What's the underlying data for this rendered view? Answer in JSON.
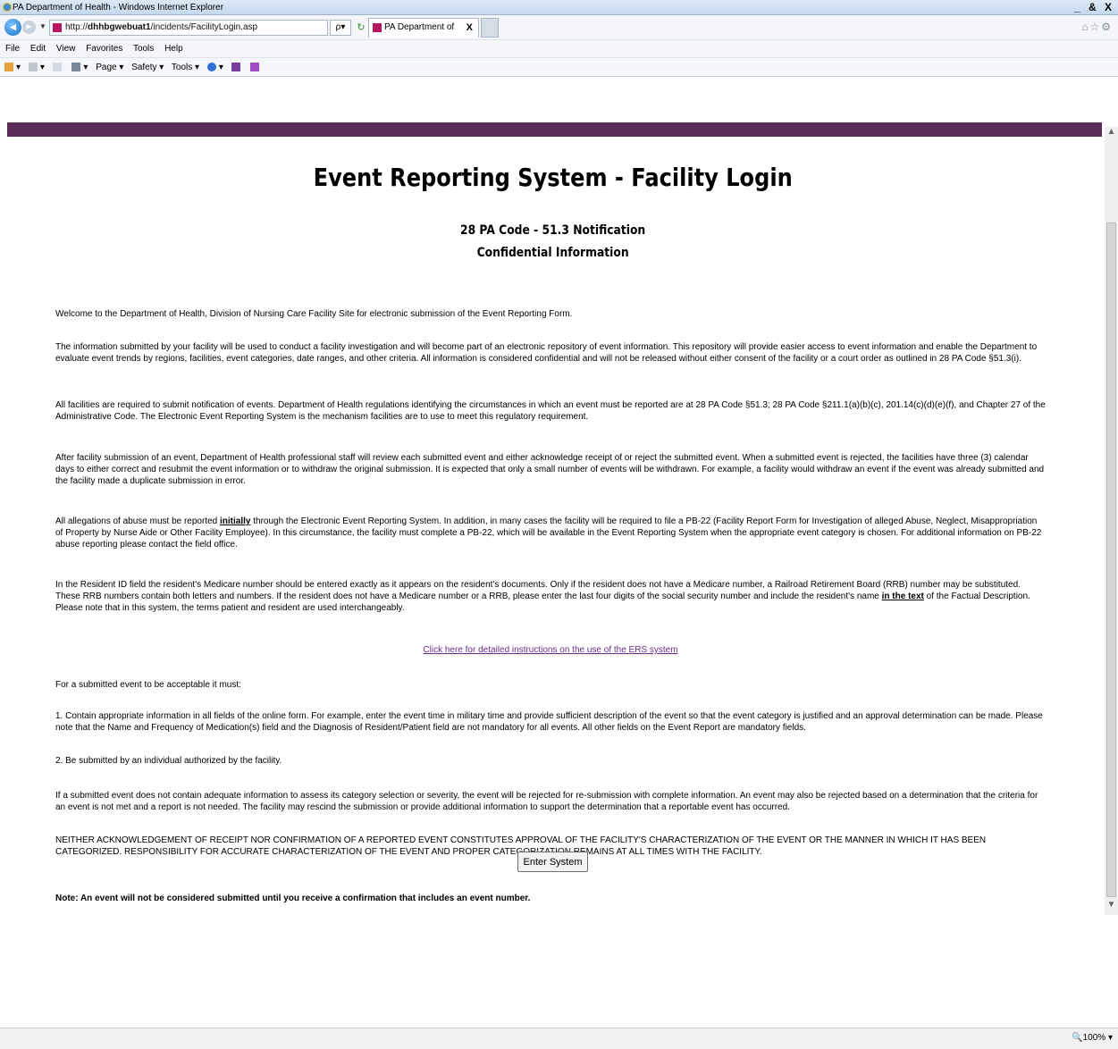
{
  "window": {
    "title": "PA Department of Health - Windows Internet Explorer",
    "controls": "_ & X"
  },
  "browser": {
    "url_prefix": "http://",
    "url_host": "dhhbgwebuat1",
    "url_path": "/incidents/FacilityLogin.asp",
    "tab_title": "PA Department of Health",
    "tab_close": "X",
    "search_glyph": "ρ▾",
    "menu": [
      "File",
      "Edit",
      "View",
      "Favorites",
      "Tools",
      "Help"
    ],
    "command_bar": [
      "Page ▾",
      "Safety ▾",
      "Tools ▾"
    ],
    "zoom": "100%"
  },
  "page": {
    "title": "Event Reporting System - Facility Login",
    "subtitle1": "28 PA Code - 51.3 Notification",
    "subtitle2": "Confidential Information",
    "p_welcome": "Welcome to the Department of Health, Division of Nursing Care Facility Site for electronic submission of the Event Reporting Form.",
    "p_info": "The information submitted by your facility will be used to conduct a facility investigation and will become part of an electronic repository of event information. This repository will provide easier access to event information and enable the Department to evaluate event trends by regions, facilities, event categories, date ranges, and other criteria. All information is considered confidential and will not be released without either consent of the facility or a court order as outlined in 28 PA Code §51.3(i).",
    "p_required": "All facilities are required to submit notification of events. Department of Health regulations identifying the circumstances in which an event must be reported are at 28 PA Code §51.3; 28 PA Code §211.1(a)(b)(c), 201.14(c)(d)(e)(f), and Chapter 27 of the Administrative Code. The Electronic Event Reporting System is the mechanism facilities are to use to meet this regulatory requirement.",
    "p_after": "After facility submission of an event, Department of Health professional staff will review each submitted event and either acknowledge receipt of or reject the submitted event. When a submitted event is rejected, the facilities have three (3) calendar days to either correct and resubmit the event information or to withdraw the original submission. It is expected that only a small number of events will be withdrawn. For example, a facility would withdraw an event if the event was already submitted and the facility made a duplicate submission in error.",
    "p_abuse_a": "All allegations of abuse must be reported ",
    "p_abuse_b": "initially",
    "p_abuse_c": " through the Electronic Event Reporting System. In addition, in many cases the facility will be required to file a PB-22 (Facility Report Form for Investigation of alleged Abuse, Neglect, Misappropriation of Property by Nurse Aide or Other Facility Employee). In this circumstance, the facility must complete a PB-22, which will be available in the Event Reporting System when the appropriate event category is chosen. For additional information on PB-22 abuse reporting please contact the field office.",
    "p_resident_a": "In the Resident ID field the resident's Medicare number should be entered exactly as it appears on the resident's documents. Only if the resident does not have a Medicare number, a Railroad Retirement Board (RRB) number may be substituted. These RRB numbers contain both letters and numbers. If the resident does not have a Medicare number or a RRB, please enter the last four digits of the social security number and include the resident's name ",
    "p_resident_b": "in the text",
    "p_resident_c": " of the Factual Description. Please note that in this system, the terms patient and resident are used interchangeably.",
    "instructions_link": "Click here for detailed instructions on the use of the ERS system",
    "p_acceptable": "For a submitted event to be acceptable it must:",
    "p_item1": "1. Contain appropriate information in all fields of the online form. For example, enter the event time in military time and provide sufficient description of the event so that the event category is justified and an approval determination can be made. Please note that the Name and Frequency of Medication(s) field and the Diagnosis of Resident/Patient field are not mandatory for all events. All other fields on the Event Report are mandatory fields.",
    "p_item2": "2. Be submitted by an individual authorized by the facility.",
    "p_rejected": "If a submitted event does not contain adequate information to assess its category selection or severity, the event will be rejected for re-submission with complete information. An event may also be rejected based on a determination that the criteria for an event is not met and a report is not needed. The facility may rescind the submission or provide additional information to support the determination that a reportable event has occurred.",
    "p_neither": "NEITHER ACKNOWLEDGEMENT OF RECEIPT NOR CONFIRMATION OF A REPORTED EVENT CONSTITUTES APPROVAL OF THE FACILITY'S CHARACTERIZATION OF THE EVENT OR THE MANNER IN WHICH IT HAS BEEN CATEGORIZED. RESPONSIBILITY FOR ACCURATE CHARACTERIZATION OF THE EVENT AND PROPER CATEGORIZATION REMAINS AT ALL TIMES WITH THE FACILITY.",
    "p_note": "Note: An event will not be considered submitted until you receive a confirmation that includes an event number.",
    "enter_button": "Enter System"
  },
  "colors": {
    "band": "#5c2b59",
    "link": "#6e2a8a"
  }
}
